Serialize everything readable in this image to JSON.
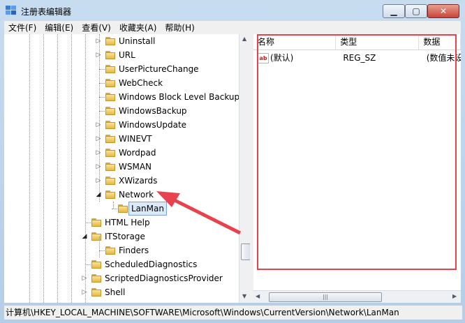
{
  "window": {
    "title": "注册表编辑器",
    "controls": {
      "minimize": "▁",
      "maximize": "▢",
      "close": "✕"
    }
  },
  "menubar": [
    "文件(F)",
    "编辑(E)",
    "查看(V)",
    "收藏夹(A)",
    "帮助(H)"
  ],
  "tree": {
    "nodes": [
      {
        "label": "Uninstall",
        "expander": "▷"
      },
      {
        "label": "URL",
        "expander": "▷"
      },
      {
        "label": "UserPictureChange",
        "expander": ""
      },
      {
        "label": "WebCheck",
        "expander": ""
      },
      {
        "label": "Windows Block Level Backup",
        "expander": ""
      },
      {
        "label": "WindowsBackup",
        "expander": ""
      },
      {
        "label": "WindowsUpdate",
        "expander": "▷"
      },
      {
        "label": "WINEVT",
        "expander": "▷"
      },
      {
        "label": "Wordpad",
        "expander": "▷"
      },
      {
        "label": "WSMAN",
        "expander": "▷"
      },
      {
        "label": "XWizards",
        "expander": "▷"
      },
      {
        "label": "Network",
        "expander": "◢"
      },
      {
        "label": "LanMan",
        "expander": ""
      },
      {
        "label": "HTML Help",
        "expander": ""
      },
      {
        "label": "ITStorage",
        "expander": "◢"
      },
      {
        "label": "Finders",
        "expander": ""
      },
      {
        "label": "ScheduledDiagnostics",
        "expander": ""
      },
      {
        "label": "ScriptedDiagnosticsProvider",
        "expander": "▷"
      },
      {
        "label": "Shell",
        "expander": "▷"
      }
    ],
    "selected": "LanMan"
  },
  "list": {
    "columns": [
      "名称",
      "类型",
      "数据"
    ],
    "rows": [
      {
        "name": "(默认)",
        "type": "REG_SZ",
        "data": "(数值未设"
      }
    ],
    "value_icon": "ab"
  },
  "statusbar": {
    "path": "计算机\\HKEY_LOCAL_MACHINE\\SOFTWARE\\Microsoft\\Windows\\CurrentVersion\\Network\\LanMan"
  },
  "annotation": {
    "color": "#e8424e"
  }
}
